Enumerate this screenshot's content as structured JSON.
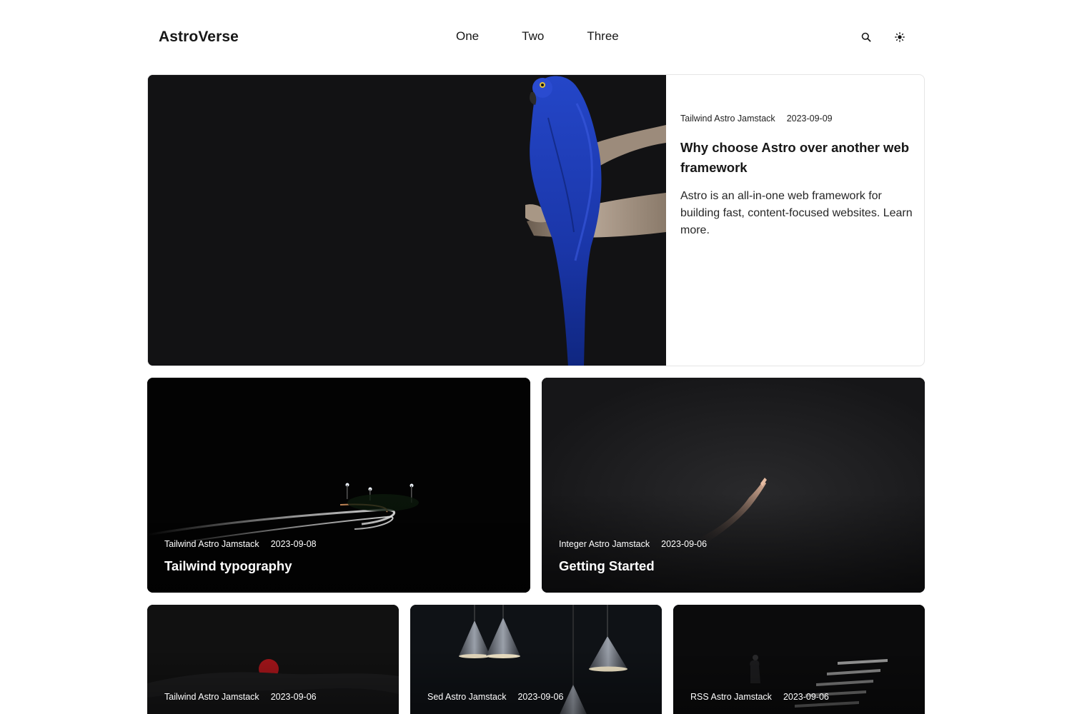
{
  "header": {
    "logo": "AstroVerse",
    "nav": [
      "One",
      "Two",
      "Three"
    ],
    "icons": {
      "search": "search-icon",
      "theme": "sun-icon"
    }
  },
  "featured": {
    "tags": "Tailwind Astro Jamstack",
    "date": "2023-09-09",
    "title": "Why choose Astro over another web framework",
    "description": "Astro is an all-in-one web framework for building fast, content-focused websites. Learn more.",
    "image": "blue-parrot-photo"
  },
  "posts": [
    {
      "tags": "Tailwind Astro Jamstack",
      "date": "2023-09-08",
      "title": "Tailwind typography",
      "image": "night-road-light-trails-photo"
    },
    {
      "tags": "Integer Astro Jamstack",
      "date": "2023-09-06",
      "title": "Getting Started",
      "image": "hand-in-dark-photo"
    },
    {
      "tags": "Tailwind Astro Jamstack",
      "date": "2023-09-06",
      "title": "",
      "image": "red-sun-over-hills-photo"
    },
    {
      "tags": "Sed Astro Jamstack",
      "date": "2023-09-06",
      "title": "",
      "image": "cone-pendant-lamps-photo"
    },
    {
      "tags": "RSS Astro Jamstack",
      "date": "2023-09-06",
      "title": "",
      "image": "dark-staircase-figure-photo"
    }
  ],
  "colors": {
    "text": "#171717",
    "border": "#e5e5e5",
    "card_dark": "#121214",
    "parrot_blue": "#1f3fbf"
  }
}
